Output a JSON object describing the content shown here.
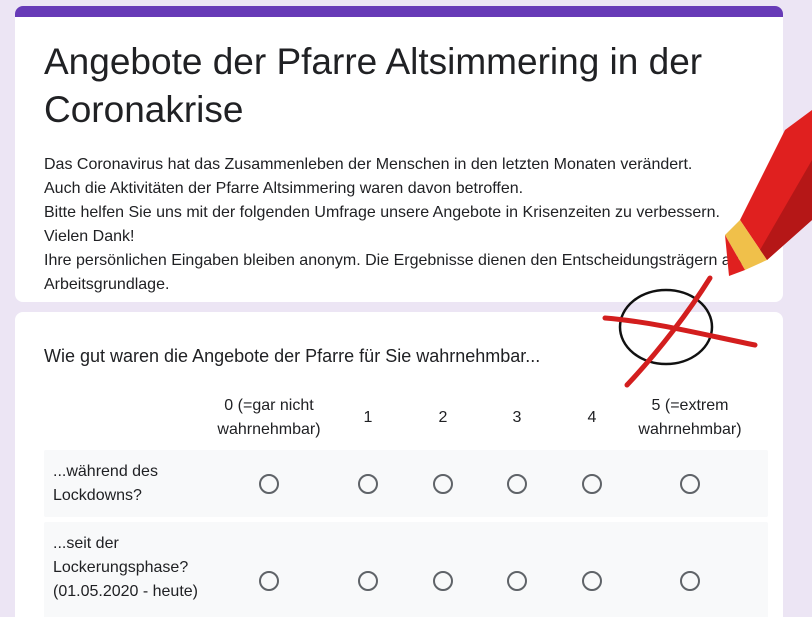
{
  "colors": {
    "accent": "#673ab7",
    "page_background": "#ece5f4",
    "radio_border": "#5f6368",
    "row_background": "#f8f9fa"
  },
  "header": {
    "title": "Angebote der Pfarre Altsimmering in der Coronakrise",
    "description": [
      "Das Coronavirus hat das Zusammenleben der Menschen in den letzten Monaten verändert.",
      "Auch die Aktivitäten der Pfarre Altsimmering waren davon betroffen.",
      "Bitte helfen Sie uns mit der folgenden Umfrage unsere Angebote in Krisenzeiten zu verbessern. Vielen Dank!",
      "Ihre persönlichen Eingaben bleiben anonym. Die Ergebnisse dienen den Entscheidungsträgern als Arbeitsgrundlage."
    ]
  },
  "question": {
    "title": "Wie gut waren die Angebote der Pfarre für Sie wahrnehmbar...",
    "columns": [
      "0 (=gar nicht\nwahrnehmbar)",
      "1",
      "2",
      "3",
      "4",
      "5 (=extrem\nwahrnehmbar)"
    ],
    "rows": [
      {
        "label": "...während des Lockdowns?",
        "selected": null
      },
      {
        "label": "...seit der Lockerungsphase? (01.05.2020 - heute)",
        "selected": null
      }
    ]
  },
  "decoration": {
    "pencil_icon": "red-pencil-icon",
    "mark_icon": "circle-with-cross-icon"
  }
}
